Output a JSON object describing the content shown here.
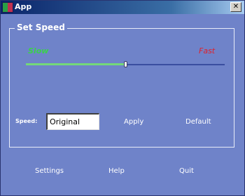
{
  "window": {
    "title": "App",
    "close_symbol": "✕"
  },
  "group": {
    "title": "Set Speed",
    "slow_label": "Slow",
    "fast_label": "Fast",
    "slider_value_fraction": 0.505
  },
  "speed": {
    "label": "Speed:",
    "value": "Original"
  },
  "buttons": {
    "apply": "Apply",
    "default": "Default"
  },
  "footer": {
    "settings": "Settings",
    "help": "Help",
    "quit": "Quit"
  },
  "colors": {
    "window_bg": "#6f83c9",
    "slow": "#3ad24a",
    "fast": "#e0202a",
    "track_filled": "#74d878",
    "track_empty": "#3a4ea0"
  }
}
